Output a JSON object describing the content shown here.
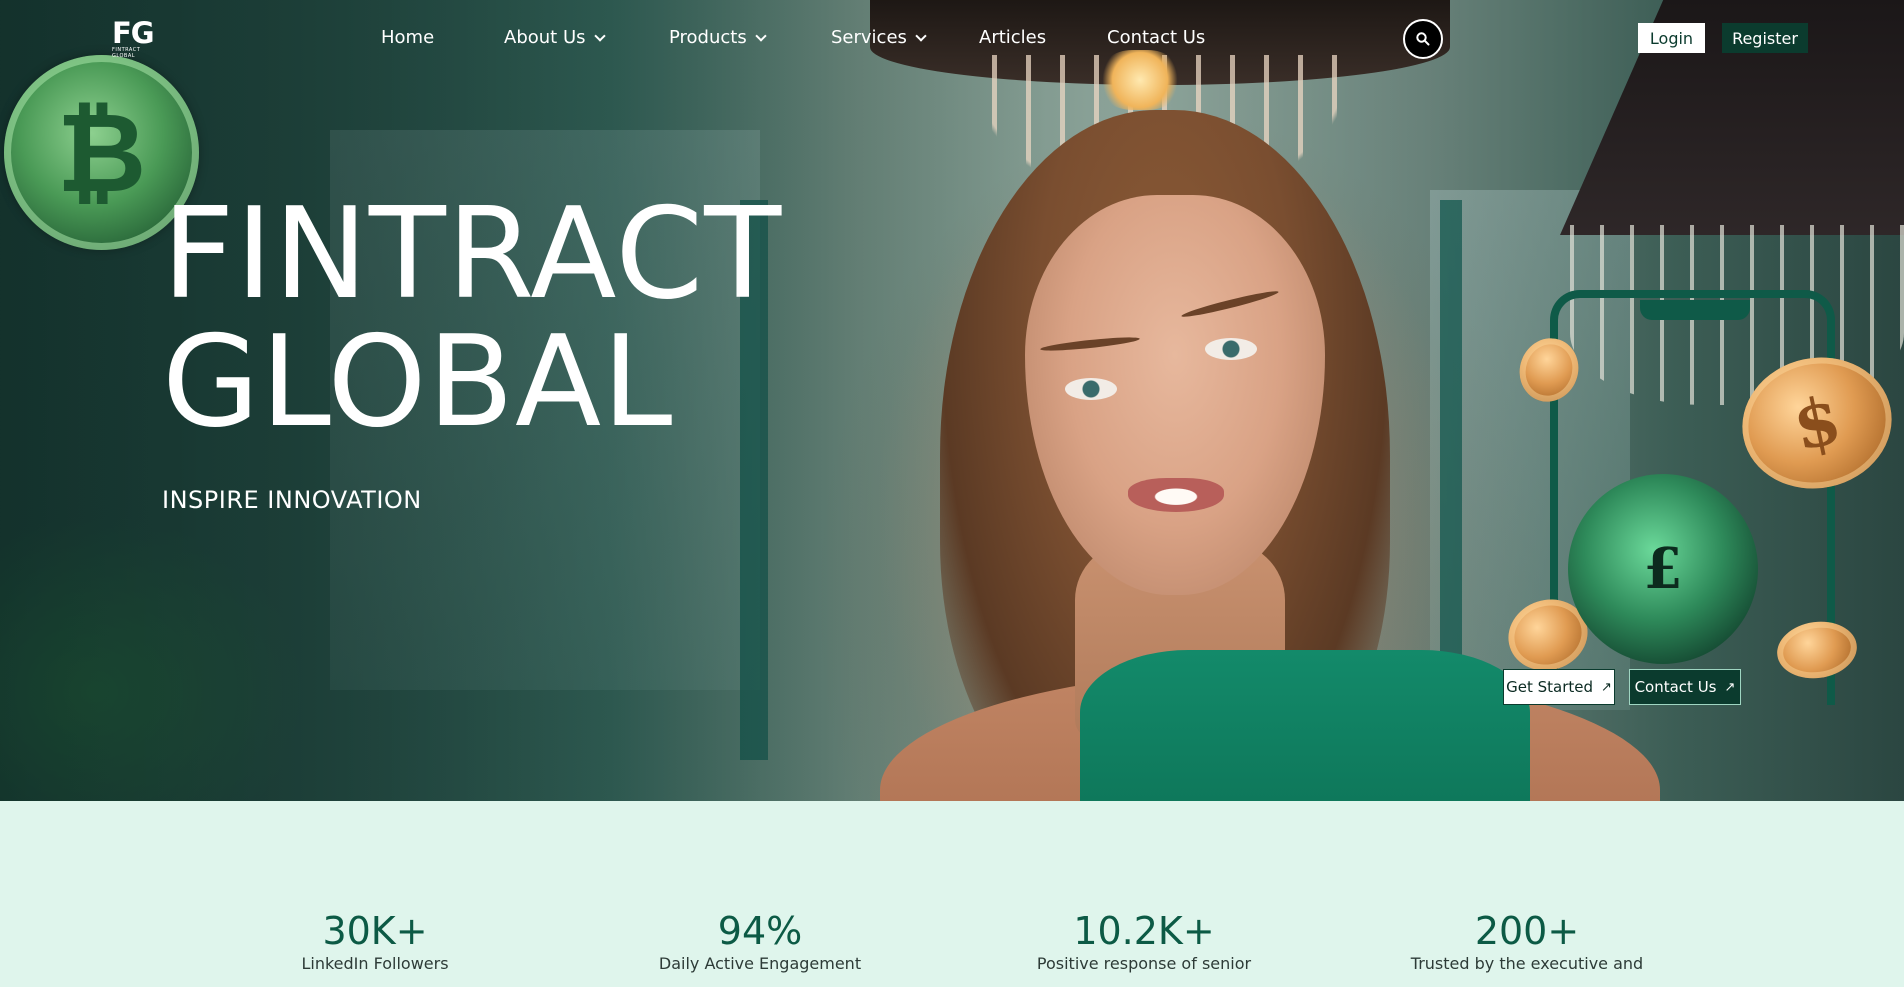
{
  "brand": {
    "logo_mark": "FG",
    "logo_sub": "FINTRACT GLOBAL"
  },
  "nav": {
    "items": [
      {
        "label": "Home",
        "has_dropdown": false
      },
      {
        "label": "About Us",
        "has_dropdown": true
      },
      {
        "label": "Products",
        "has_dropdown": true
      },
      {
        "label": "Services",
        "has_dropdown": true
      },
      {
        "label": "Articles",
        "has_dropdown": false
      },
      {
        "label": "Contact Us",
        "has_dropdown": false
      }
    ],
    "search_icon": "search-icon",
    "login_label": "Login",
    "register_label": "Register"
  },
  "hero": {
    "title_line1": "FINTRACT",
    "title_line2": "GLOBAL",
    "subtitle": "INSPIRE INNOVATION",
    "get_started_label": "Get Started",
    "contact_label": "Contact Us",
    "arrow_icon": "arrow-up-right-icon"
  },
  "stats": [
    {
      "value": "30K+",
      "label": "LinkedIn Followers"
    },
    {
      "value": "94%",
      "label": "Daily Active Engagement"
    },
    {
      "value": "10.2K+",
      "label": "Positive response of senior"
    },
    {
      "value": "200+",
      "label": "Trusted by the executive and"
    }
  ],
  "colors": {
    "accent_dark": "#0b3b2e",
    "accent_green": "#0c5a45",
    "stats_bg": "#dff5ec",
    "text_white": "#ffffff"
  }
}
